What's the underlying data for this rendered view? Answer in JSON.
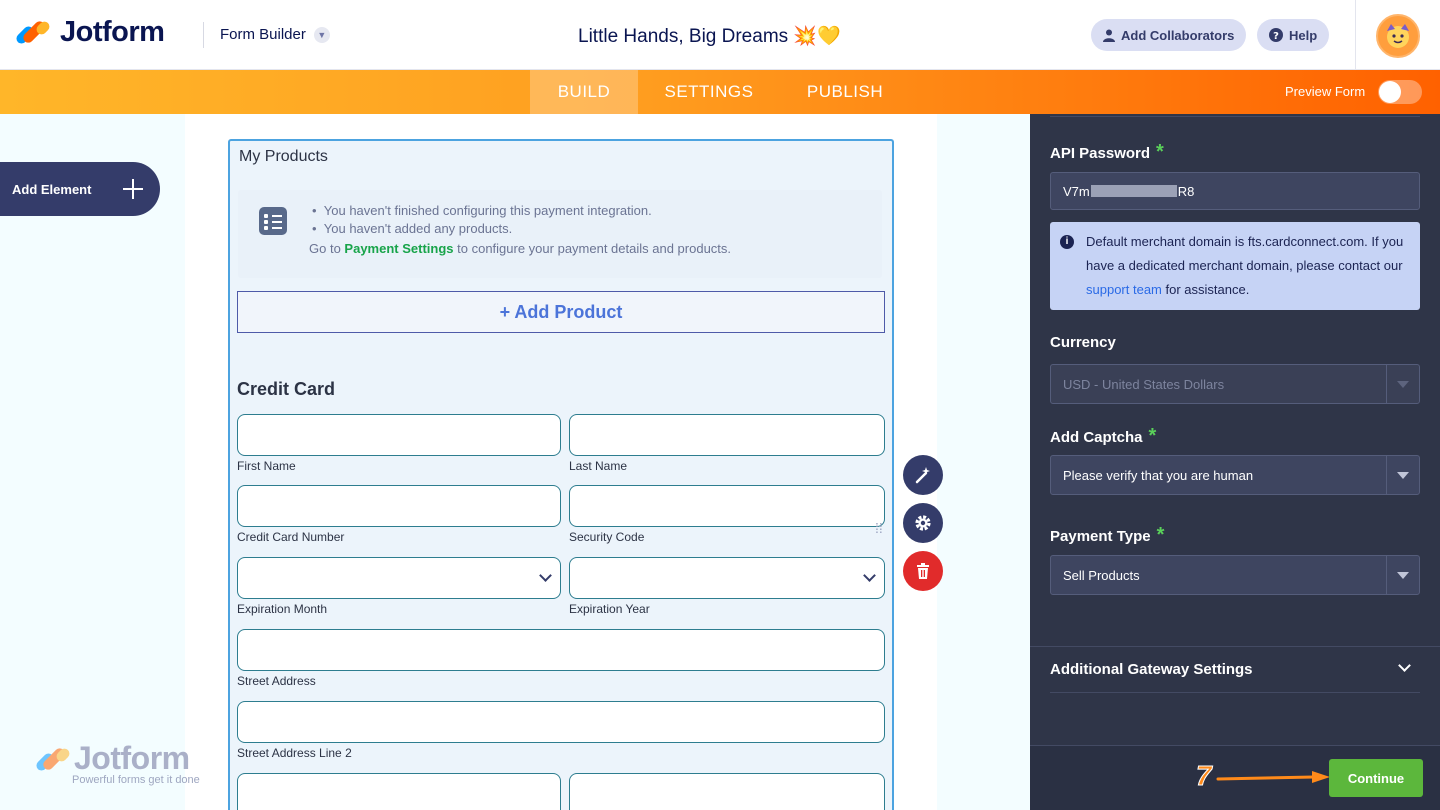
{
  "header": {
    "logo_text": "Jotform",
    "form_builder_label": "Form Builder",
    "form_title": "Little Hands, Big Dreams 💥💛",
    "add_collaborators_label": "Add Collaborators",
    "help_label": "Help"
  },
  "nav": {
    "tabs": [
      {
        "label": "BUILD",
        "active": true
      },
      {
        "label": "SETTINGS",
        "active": false
      },
      {
        "label": "PUBLISH",
        "active": false
      }
    ],
    "preview_label": "Preview Form",
    "preview_enabled": false
  },
  "sidebar": {
    "add_element_label": "Add Element"
  },
  "form": {
    "products_title": "My Products",
    "notice_line1": "You haven't finished configuring this payment integration.",
    "notice_line2": "You haven't added any products.",
    "notice_goto": "Go to",
    "notice_link": "Payment Settings",
    "notice_suffix": "to configure your payment details and products.",
    "add_product_label": "+ Add Product",
    "credit_card_title": "Credit Card",
    "fields": {
      "first_name": "First Name",
      "last_name": "Last Name",
      "cc_number": "Credit Card Number",
      "security_code": "Security Code",
      "exp_month": "Expiration Month",
      "exp_year": "Expiration Year",
      "street": "Street Address",
      "street2": "Street Address Line 2"
    }
  },
  "watermark": {
    "text": "Jotform",
    "tagline": "Powerful forms get it done"
  },
  "panel": {
    "api_password_label": "API Password",
    "api_password_start": "V7m",
    "api_password_end": "R8",
    "info_text": "Default merchant domain is fts.cardconnect.com. If you have a dedicated merchant domain, please contact our",
    "info_link": "support team",
    "info_suffix": "for assistance.",
    "currency_label": "Currency",
    "currency_value": "USD - United States Dollars",
    "captcha_label": "Add Captcha",
    "captcha_value": "Please verify that you are human",
    "payment_type_label": "Payment Type",
    "payment_type_value": "Sell Products",
    "additional_label": "Additional Gateway Settings",
    "continue_label": "Continue",
    "step_number": "7"
  },
  "colors": {
    "accent_orange": "#ff6100",
    "panel_bg": "#2f3548",
    "continue_green": "#5cb73c",
    "required_green": "#5ad05a"
  }
}
